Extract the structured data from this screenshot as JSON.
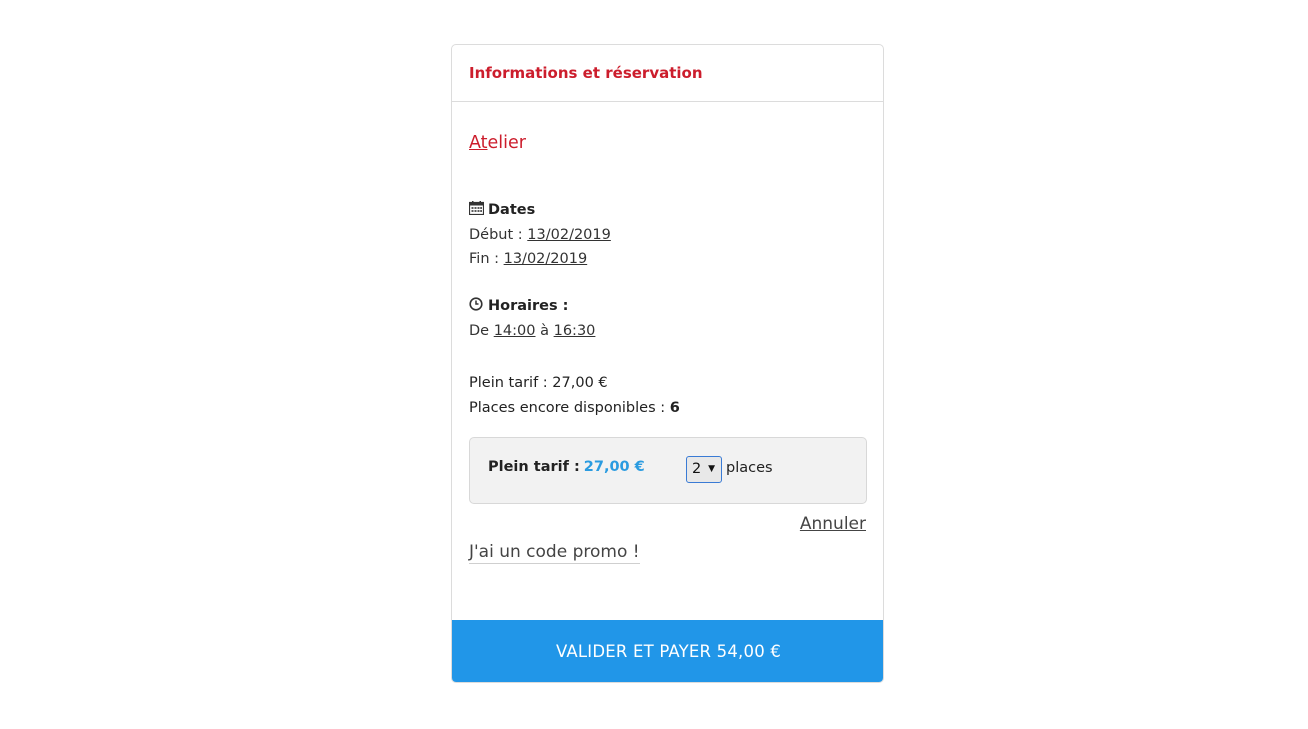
{
  "card": {
    "header_title": "Informations et réservation",
    "event_title_first": "At",
    "event_title_rest": "elier"
  },
  "dates": {
    "heading": "Dates",
    "start_label": "Début : ",
    "start_value": "13/02/2019",
    "end_label": "Fin : ",
    "end_value": "13/02/2019"
  },
  "hours": {
    "heading": "Horaires :",
    "from_label": "De ",
    "from_value": "14:00",
    "to_label": " à ",
    "to_value": "16:30"
  },
  "pricing": {
    "full_price_line": "Plein tarif : 27,00 €",
    "places_label": "Places encore disponibles : ",
    "places_value": "6"
  },
  "ticket": {
    "label": "Plein tarif :",
    "price": "27,00 €",
    "quantity": "2",
    "unit": "places"
  },
  "actions": {
    "cancel_label": "Annuler",
    "promo_label": "J'ai un code promo !",
    "pay_label": "VALIDER ET PAYER 54,00 €"
  },
  "icons": {
    "dates": "calendar-icon",
    "hours": "clock-icon",
    "select": "caret-down-icon"
  },
  "colors": {
    "accent_red": "#cc1d2c",
    "accent_blue": "#2196e8",
    "price_blue": "#2a9be0"
  }
}
